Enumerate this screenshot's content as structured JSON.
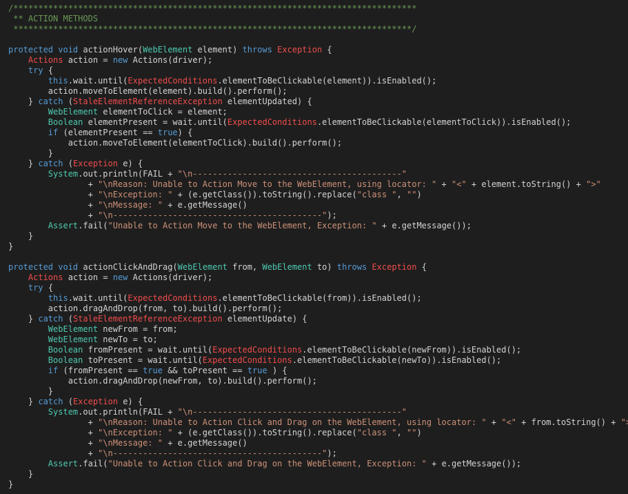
{
  "colors": {
    "background": "#1e1e1e",
    "comment": "#6a9955",
    "keyword": "#569cd6",
    "type": "#4ec9b0",
    "exception_type": "#f14c4c",
    "string": "#ce9178",
    "plain": "#d4d4d4"
  },
  "lines": [
    [
      {
        "t": "/*********************************************************************************",
        "c": "comment"
      }
    ],
    [
      {
        "t": " ** ACTION METHODS",
        "c": "comment"
      }
    ],
    [
      {
        "t": " ********************************************************************************/",
        "c": "comment"
      }
    ],
    [],
    [
      {
        "t": "protected void ",
        "c": "kw"
      },
      {
        "t": "actionHover(",
        "c": "plain"
      },
      {
        "t": "WebElement",
        "c": "type"
      },
      {
        "t": " element) ",
        "c": "plain"
      },
      {
        "t": "throws",
        "c": "kw"
      },
      {
        "t": " ",
        "c": "plain"
      },
      {
        "t": "Exception",
        "c": "excl"
      },
      {
        "t": " {",
        "c": "plain"
      }
    ],
    [
      {
        "t": "    ",
        "c": "plain"
      },
      {
        "t": "Actions",
        "c": "excl"
      },
      {
        "t": " action = ",
        "c": "plain"
      },
      {
        "t": "new",
        "c": "kw"
      },
      {
        "t": " Actions(driver);",
        "c": "plain"
      }
    ],
    [
      {
        "t": "    ",
        "c": "plain"
      },
      {
        "t": "try",
        "c": "kw"
      },
      {
        "t": " {",
        "c": "plain"
      }
    ],
    [
      {
        "t": "        ",
        "c": "plain"
      },
      {
        "t": "this",
        "c": "kw"
      },
      {
        "t": ".wait.until(",
        "c": "plain"
      },
      {
        "t": "ExpectedConditions",
        "c": "excl"
      },
      {
        "t": ".elementToBeClickable(element)).isEnabled();",
        "c": "plain"
      }
    ],
    [
      {
        "t": "        action.moveToElement(element).build().perform();",
        "c": "plain"
      }
    ],
    [
      {
        "t": "    } ",
        "c": "plain"
      },
      {
        "t": "catch",
        "c": "kw"
      },
      {
        "t": " (",
        "c": "plain"
      },
      {
        "t": "StaleElementReferenceException",
        "c": "excl"
      },
      {
        "t": " elementUpdated) {",
        "c": "plain"
      }
    ],
    [
      {
        "t": "        ",
        "c": "plain"
      },
      {
        "t": "WebElement",
        "c": "type"
      },
      {
        "t": " elementToClick = element;",
        "c": "plain"
      }
    ],
    [
      {
        "t": "        ",
        "c": "plain"
      },
      {
        "t": "Boolean",
        "c": "type"
      },
      {
        "t": " elementPresent = wait.until(",
        "c": "plain"
      },
      {
        "t": "ExpectedConditions",
        "c": "excl"
      },
      {
        "t": ".elementToBeClickable(elementToClick)).isEnabled();",
        "c": "plain"
      }
    ],
    [
      {
        "t": "        ",
        "c": "plain"
      },
      {
        "t": "if",
        "c": "kw"
      },
      {
        "t": " (elementPresent == ",
        "c": "plain"
      },
      {
        "t": "true",
        "c": "kw"
      },
      {
        "t": ") {",
        "c": "plain"
      }
    ],
    [
      {
        "t": "            action.moveToElement(elementToClick).build().perform();",
        "c": "plain"
      }
    ],
    [
      {
        "t": "        }",
        "c": "plain"
      }
    ],
    [
      {
        "t": "    } ",
        "c": "plain"
      },
      {
        "t": "catch",
        "c": "kw"
      },
      {
        "t": " (",
        "c": "plain"
      },
      {
        "t": "Exception",
        "c": "excl"
      },
      {
        "t": " e) {",
        "c": "plain"
      }
    ],
    [
      {
        "t": "        ",
        "c": "plain"
      },
      {
        "t": "System",
        "c": "type"
      },
      {
        "t": ".out.println(FAIL + ",
        "c": "plain"
      },
      {
        "t": "\"\\n------------------------------------------\"",
        "c": "str"
      }
    ],
    [
      {
        "t": "                + ",
        "c": "plain"
      },
      {
        "t": "\"\\nReason: Unable to Action Move to the WebElement, using locator: \"",
        "c": "str"
      },
      {
        "t": " + ",
        "c": "plain"
      },
      {
        "t": "\"<\"",
        "c": "str"
      },
      {
        "t": " + element.toString() + ",
        "c": "plain"
      },
      {
        "t": "\">\"",
        "c": "str"
      }
    ],
    [
      {
        "t": "                + ",
        "c": "plain"
      },
      {
        "t": "\"\\nException: \"",
        "c": "str"
      },
      {
        "t": " + (e.getClass()).toString().replace(",
        "c": "plain"
      },
      {
        "t": "\"class \"",
        "c": "str"
      },
      {
        "t": ", ",
        "c": "plain"
      },
      {
        "t": "\"\"",
        "c": "str"
      },
      {
        "t": ")",
        "c": "plain"
      }
    ],
    [
      {
        "t": "                + ",
        "c": "plain"
      },
      {
        "t": "\"\\nMessage: \"",
        "c": "str"
      },
      {
        "t": " + e.getMessage()",
        "c": "plain"
      }
    ],
    [
      {
        "t": "                + ",
        "c": "plain"
      },
      {
        "t": "\"\\n------------------------------------------\"",
        "c": "str"
      },
      {
        "t": ");",
        "c": "plain"
      }
    ],
    [
      {
        "t": "        ",
        "c": "plain"
      },
      {
        "t": "Assert",
        "c": "type"
      },
      {
        "t": ".fail(",
        "c": "plain"
      },
      {
        "t": "\"Unable to Action Move to the WebElement, Exception: \"",
        "c": "str"
      },
      {
        "t": " + e.getMessage());",
        "c": "plain"
      }
    ],
    [
      {
        "t": "    }",
        "c": "plain"
      }
    ],
    [
      {
        "t": "}",
        "c": "plain"
      }
    ],
    [],
    [
      {
        "t": "protected void ",
        "c": "kw"
      },
      {
        "t": "actionClickAndDrag(",
        "c": "plain"
      },
      {
        "t": "WebElement",
        "c": "type"
      },
      {
        "t": " from, ",
        "c": "plain"
      },
      {
        "t": "WebElement",
        "c": "type"
      },
      {
        "t": " to) ",
        "c": "plain"
      },
      {
        "t": "throws",
        "c": "kw"
      },
      {
        "t": " ",
        "c": "plain"
      },
      {
        "t": "Exception",
        "c": "excl"
      },
      {
        "t": " {",
        "c": "plain"
      }
    ],
    [
      {
        "t": "    ",
        "c": "plain"
      },
      {
        "t": "Actions",
        "c": "excl"
      },
      {
        "t": " action = ",
        "c": "plain"
      },
      {
        "t": "new",
        "c": "kw"
      },
      {
        "t": " Actions(driver);",
        "c": "plain"
      }
    ],
    [
      {
        "t": "    ",
        "c": "plain"
      },
      {
        "t": "try",
        "c": "kw"
      },
      {
        "t": " {",
        "c": "plain"
      }
    ],
    [
      {
        "t": "        ",
        "c": "plain"
      },
      {
        "t": "this",
        "c": "kw"
      },
      {
        "t": ".wait.until(",
        "c": "plain"
      },
      {
        "t": "ExpectedConditions",
        "c": "excl"
      },
      {
        "t": ".elementToBeClickable(from)).isEnabled();",
        "c": "plain"
      }
    ],
    [
      {
        "t": "        action.dragAndDrop(from, to).build().perform();",
        "c": "plain"
      }
    ],
    [
      {
        "t": "    } ",
        "c": "plain"
      },
      {
        "t": "catch",
        "c": "kw"
      },
      {
        "t": " (",
        "c": "plain"
      },
      {
        "t": "StaleElementReferenceException",
        "c": "excl"
      },
      {
        "t": " elementUpdate) {",
        "c": "plain"
      }
    ],
    [
      {
        "t": "        ",
        "c": "plain"
      },
      {
        "t": "WebElement",
        "c": "type"
      },
      {
        "t": " newFrom = from;",
        "c": "plain"
      }
    ],
    [
      {
        "t": "        ",
        "c": "plain"
      },
      {
        "t": "WebElement",
        "c": "type"
      },
      {
        "t": " newTo = to;",
        "c": "plain"
      }
    ],
    [
      {
        "t": "        ",
        "c": "plain"
      },
      {
        "t": "Boolean",
        "c": "type"
      },
      {
        "t": " fromPresent = wait.until(",
        "c": "plain"
      },
      {
        "t": "ExpectedConditions",
        "c": "excl"
      },
      {
        "t": ".elementToBeClickable(newFrom)).isEnabled();",
        "c": "plain"
      }
    ],
    [
      {
        "t": "        ",
        "c": "plain"
      },
      {
        "t": "Boolean",
        "c": "type"
      },
      {
        "t": " toPresent = wait.until(",
        "c": "plain"
      },
      {
        "t": "ExpectedConditions",
        "c": "excl"
      },
      {
        "t": ".elementToBeClickable(newTo)).isEnabled();",
        "c": "plain"
      }
    ],
    [
      {
        "t": "        ",
        "c": "plain"
      },
      {
        "t": "if",
        "c": "kw"
      },
      {
        "t": " (fromPresent == ",
        "c": "plain"
      },
      {
        "t": "true",
        "c": "kw"
      },
      {
        "t": " && toPresent == ",
        "c": "plain"
      },
      {
        "t": "true",
        "c": "kw"
      },
      {
        "t": " ) {",
        "c": "plain"
      }
    ],
    [
      {
        "t": "            action.dragAndDrop(newFrom, to).build().perform();",
        "c": "plain"
      }
    ],
    [
      {
        "t": "        }",
        "c": "plain"
      }
    ],
    [
      {
        "t": "    } ",
        "c": "plain"
      },
      {
        "t": "catch",
        "c": "kw"
      },
      {
        "t": " (",
        "c": "plain"
      },
      {
        "t": "Exception",
        "c": "excl"
      },
      {
        "t": " e) {",
        "c": "plain"
      }
    ],
    [
      {
        "t": "        ",
        "c": "plain"
      },
      {
        "t": "System",
        "c": "type"
      },
      {
        "t": ".out.println(FAIL + ",
        "c": "plain"
      },
      {
        "t": "\"\\n------------------------------------------\"",
        "c": "str"
      }
    ],
    [
      {
        "t": "                + ",
        "c": "plain"
      },
      {
        "t": "\"\\nReason: Unable to Action Click and Drag on the WebElement, using locator: \"",
        "c": "str"
      },
      {
        "t": " + ",
        "c": "plain"
      },
      {
        "t": "\"<\"",
        "c": "str"
      },
      {
        "t": " + from.toString() + ",
        "c": "plain"
      },
      {
        "t": "\">\"",
        "c": "str"
      }
    ],
    [
      {
        "t": "                + ",
        "c": "plain"
      },
      {
        "t": "\"\\nException: \"",
        "c": "str"
      },
      {
        "t": " + (e.getClass()).toString().replace(",
        "c": "plain"
      },
      {
        "t": "\"class \"",
        "c": "str"
      },
      {
        "t": ", ",
        "c": "plain"
      },
      {
        "t": "\"\"",
        "c": "str"
      },
      {
        "t": ")",
        "c": "plain"
      }
    ],
    [
      {
        "t": "                + ",
        "c": "plain"
      },
      {
        "t": "\"\\nMessage: \"",
        "c": "str"
      },
      {
        "t": " + e.getMessage()",
        "c": "plain"
      }
    ],
    [
      {
        "t": "                + ",
        "c": "plain"
      },
      {
        "t": "\"\\n------------------------------------------\"",
        "c": "str"
      },
      {
        "t": ");",
        "c": "plain"
      }
    ],
    [
      {
        "t": "        ",
        "c": "plain"
      },
      {
        "t": "Assert",
        "c": "type"
      },
      {
        "t": ".fail(",
        "c": "plain"
      },
      {
        "t": "\"Unable to Action Click and Drag on the WebElement, Exception: \"",
        "c": "str"
      },
      {
        "t": " + e.getMessage());",
        "c": "plain"
      }
    ],
    [
      {
        "t": "    }",
        "c": "plain"
      }
    ],
    [
      {
        "t": "}",
        "c": "plain"
      }
    ]
  ]
}
